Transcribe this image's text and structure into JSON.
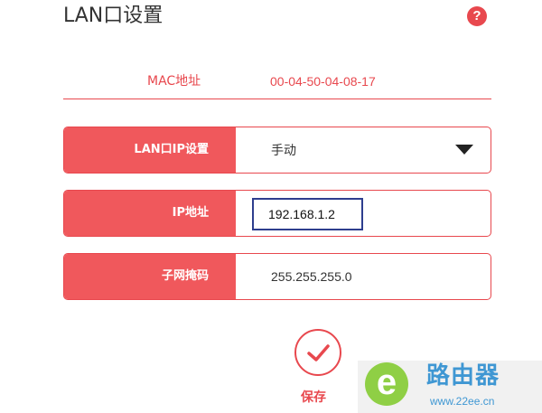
{
  "header": {
    "title": "LAN口设置",
    "help_icon": "help-icon",
    "help_glyph": "?"
  },
  "mac": {
    "label": "MAC地址",
    "value": "00-04-50-04-08-17"
  },
  "lan_ip_mode": {
    "label": "LAN口IP设置",
    "value": "手动"
  },
  "ip_address": {
    "label": "IP地址",
    "value": "192.168.1.2"
  },
  "subnet_mask": {
    "label": "子网掩码",
    "value": "255.255.255.0"
  },
  "save": {
    "label": "保存",
    "icon": "checkmark-icon"
  },
  "watermark": {
    "logo_glyph": "e",
    "title": "路由器",
    "url": "www.22ee.cn"
  },
  "colors": {
    "accent": "#e8484e",
    "label_bg": "#f0585c",
    "input_focus_border": "#2e3e8e",
    "watermark_green": "#8fcf45",
    "watermark_blue": "#3f97d3"
  }
}
